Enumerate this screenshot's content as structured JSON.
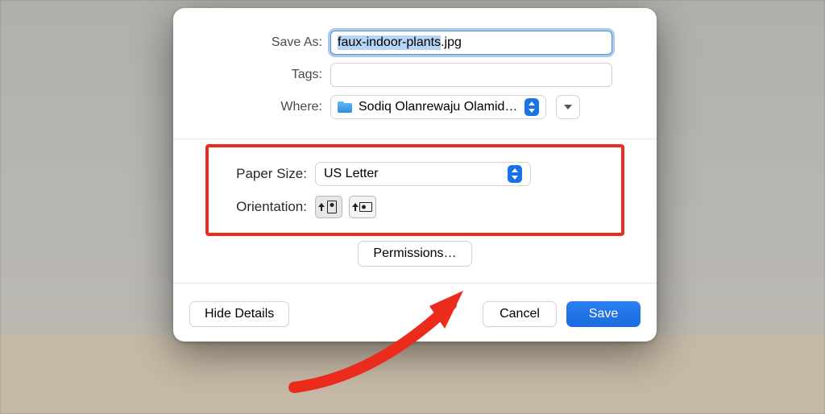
{
  "saveAs": {
    "label": "Save As:",
    "value": "faux-indoor-plants.jpg",
    "selected_stem": "faux-indoor-plants",
    "ext": ".jpg"
  },
  "tags": {
    "label": "Tags:",
    "value": ""
  },
  "where": {
    "label": "Where:",
    "value": "Sodiq Olanrewaju Olamid…"
  },
  "paperSize": {
    "label": "Paper Size:",
    "value": "US Letter"
  },
  "orientation": {
    "label": "Orientation:"
  },
  "permissions": {
    "label": "Permissions…"
  },
  "footer": {
    "hideDetails": "Hide Details",
    "cancel": "Cancel",
    "save": "Save"
  }
}
